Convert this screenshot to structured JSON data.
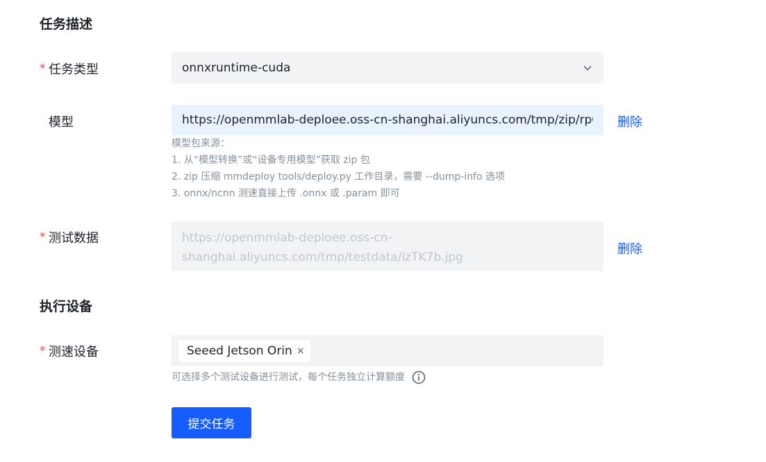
{
  "sections": {
    "task_description": "任务描述",
    "execution_device": "执行设备"
  },
  "task_type": {
    "required_mark": "*",
    "label": "任务类型",
    "value": "onnxruntime-cuda",
    "chevron_icon": "chevron-down-icon"
  },
  "model": {
    "label": "模型",
    "value": "https://openmmlab-deploee.oss-cn-shanghai.aliyuncs.com/tmp/zip/rpQcwo.zip",
    "delete_label": "删除",
    "help_lines": [
      "模型包来源：",
      "1. 从“模型转换”或“设备专用模型”获取 zip 包",
      "2. zip 压缩 mmdeploy tools/deploy.py 工作目录，需要 --dump-info 选项",
      "3. onnx/ncnn 测速直接上传 .onnx 或 .param 即可"
    ]
  },
  "test_data": {
    "required_mark": "*",
    "label": "测试数据",
    "value_line1": "https://openmmlab-deploee.oss-cn-",
    "value_line2": "shanghai.aliyuncs.com/tmp/testdata/izTK7b.jpg",
    "delete_label": "删除"
  },
  "speed_device": {
    "required_mark": "*",
    "label": "测速设备",
    "tags": [
      "Seeed Jetson Orin"
    ],
    "tag_close": "×",
    "help": "可选择多个测试设备进行测试，每个任务独立计算额度",
    "info_icon": "info-circle-icon"
  },
  "submit_label": "提交任务",
  "colors": {
    "primary": "#165dff",
    "required": "#f53f3f",
    "field_bg": "#f2f3f5",
    "active_field_bg": "#e8f3ff"
  }
}
